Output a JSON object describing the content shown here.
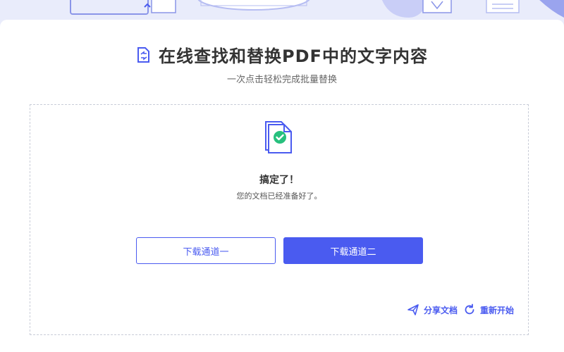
{
  "colors": {
    "accent": "#4a5bf0",
    "banner": "#e9ecfb",
    "title": "#333333",
    "success": "#27c07d"
  },
  "header": {
    "title": "在线查找和替换PDF中的文字内容",
    "subtitle": "一次点击轻松完成批量替换",
    "icon": "pdf-replace-icon"
  },
  "result": {
    "icon": "document-check-icon",
    "title": "搞定了！",
    "message": "您的文档已经准备好了。"
  },
  "buttons": {
    "download_one": "下载通道一",
    "download_two": "下载通道二"
  },
  "actions": {
    "share_label": "分享文档",
    "share_icon": "send-icon",
    "restart_label": "重新开始",
    "restart_icon": "restart-icon"
  }
}
